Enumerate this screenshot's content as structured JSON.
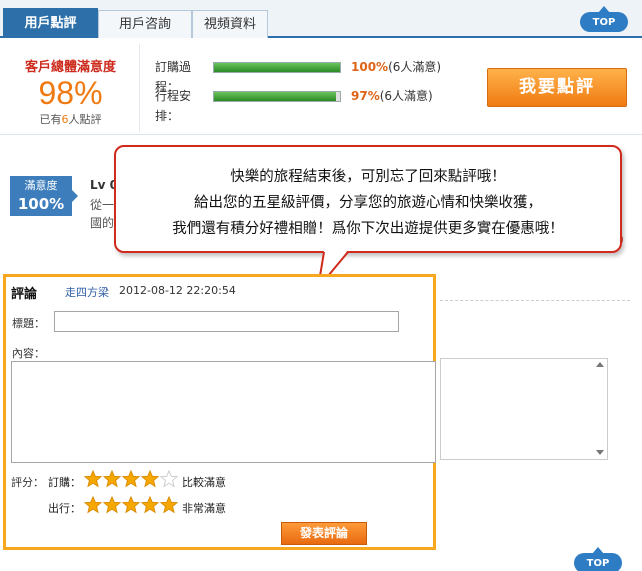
{
  "tabs": [
    {
      "label": "用戶點評",
      "active": true
    },
    {
      "label": "用戶咨詢",
      "active": false
    },
    {
      "label": "視頻資料",
      "active": false
    }
  ],
  "top_label": "TOP",
  "summary": {
    "title": "客戶總體滿意度",
    "percent": "98%",
    "count_prefix": "已有",
    "count_num": "6",
    "count_suffix": "人點評",
    "ratings": [
      {
        "label": "訂購過程：",
        "level": 1.0,
        "pct": "100%",
        "note": "(6人滿意)"
      },
      {
        "label": "行程安排：",
        "level": 0.97,
        "pct": "97%",
        "note": "(6人滿意)"
      }
    ],
    "review_button": "我要點評"
  },
  "background_review": {
    "badge_label": "滿意度",
    "badge_value": "100%",
    "user": "Lv 0",
    "text1": "從一",
    "text2": "國的",
    "red_fragment": "0"
  },
  "bubble": {
    "line1": "快樂的旅程結束後，可別忘了回來點評哦！",
    "line2": "給出您的五星級評價，分享您的旅遊心情和快樂收獲，",
    "line3": "我們還有積分好禮相贈！爲你下次出遊提供更多實在優惠哦！"
  },
  "form": {
    "header_title": "評論",
    "username": "走四方梁",
    "date": "2012-08-12 22:20:54",
    "title_label": "標題：",
    "title_value": "",
    "content_label": "內容：",
    "content_value": "",
    "score_label": "評分：",
    "ratings": [
      {
        "label": "訂購：",
        "stars": 4,
        "max": 5,
        "desc": "比較滿意"
      },
      {
        "label": "出行：",
        "stars": 5,
        "max": 5,
        "desc": "非常滿意"
      }
    ],
    "submit_label": "發表評論"
  },
  "colors": {
    "accent_blue": "#2d6fa8",
    "orange": "#f07a12",
    "red": "#d12a1c",
    "form_border": "#f7a81e",
    "star_gold": "#f6a800"
  }
}
